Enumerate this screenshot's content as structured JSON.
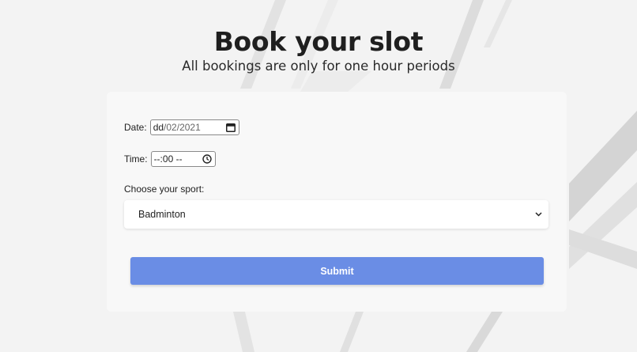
{
  "page": {
    "title": "Book your slot",
    "subtitle": "All bookings are only for one hour periods"
  },
  "form": {
    "date": {
      "label": "Date:",
      "day": "dd",
      "rest": "/02/2021",
      "icon": "calendar-icon"
    },
    "time": {
      "label": "Time:",
      "value": "--:00 --",
      "icon": "clock-icon"
    },
    "sport": {
      "label": "Choose your sport:",
      "selected": "Badminton",
      "icon": "chevron-down-icon"
    },
    "submit_label": "Submit"
  },
  "colors": {
    "accent": "#6a8de5",
    "card": "#f8f8f8",
    "background": "#f3f3f3"
  }
}
